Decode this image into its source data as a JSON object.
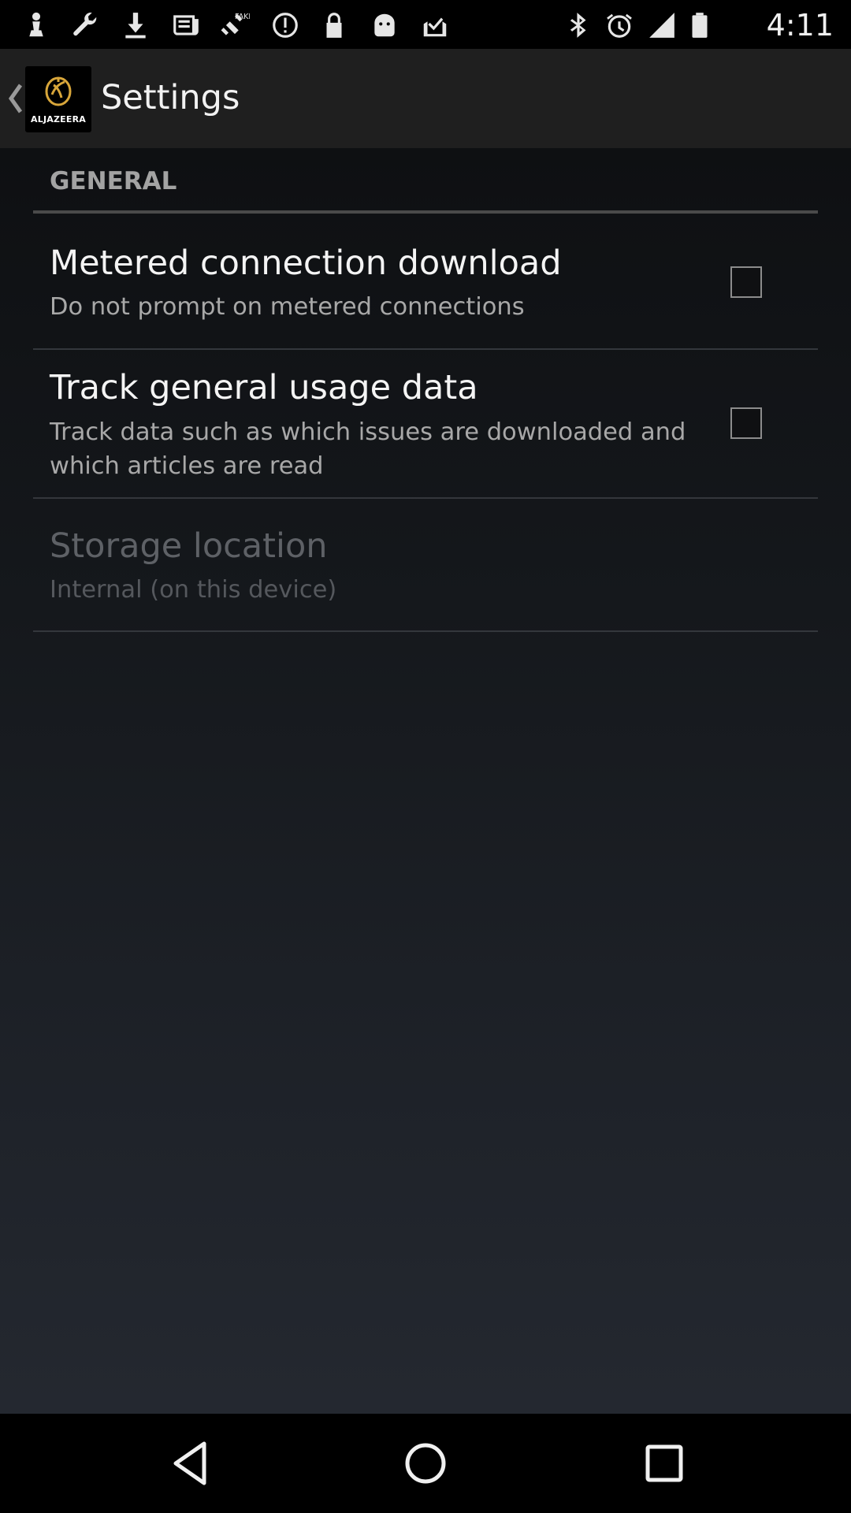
{
  "status_bar": {
    "time": "4:11",
    "left_icons": [
      "chess-pawn-icon",
      "wrench-icon",
      "download-icon",
      "news-icon",
      "satellite-icon",
      "alert-icon",
      "lock-icon",
      "android-icon",
      "inbox-check-icon"
    ],
    "right_icons": [
      "bluetooth-icon",
      "alarm-icon",
      "signal-icon",
      "battery-icon"
    ],
    "fake_label": "FAKE"
  },
  "action_bar": {
    "title": "Settings",
    "logo_text": "ALJAZEERA"
  },
  "settings": {
    "section_header": "GENERAL",
    "items": [
      {
        "title": "Metered connection download",
        "summary": "Do not prompt on metered connections",
        "checked": false
      },
      {
        "title": "Track general usage data",
        "summary": "Track data such as which issues are downloaded and which articles are read",
        "checked": false
      },
      {
        "title": "Storage location",
        "summary": "Internal (on this device)",
        "enabled": false
      }
    ]
  },
  "nav_bar": {
    "buttons": [
      "back-icon",
      "home-icon",
      "recents-icon"
    ]
  },
  "colors": {
    "status_bar_bg": "#000000",
    "action_bar_bg": "#1f1f1f",
    "title_text": "#f4f4f4",
    "summary_text": "#a8a8a8",
    "disabled_text": "#5e6166"
  }
}
